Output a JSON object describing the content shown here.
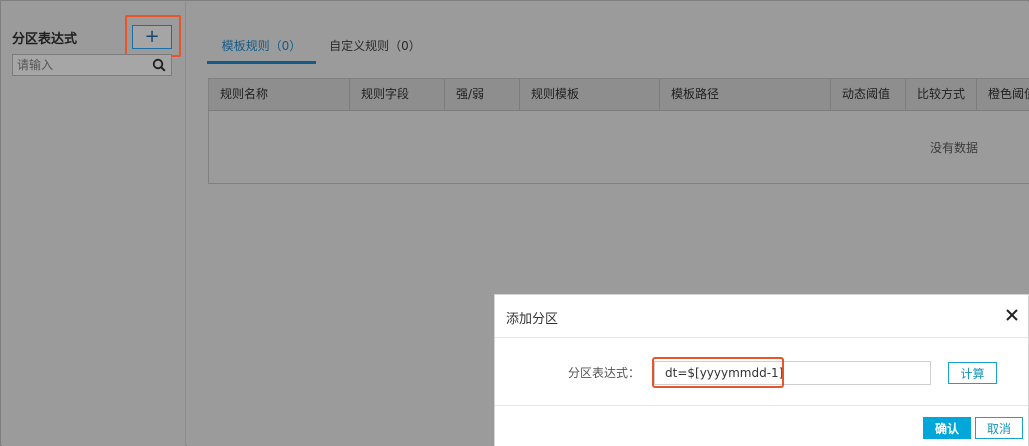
{
  "sidebar": {
    "title": "分区表达式",
    "add_label": "+",
    "search_placeholder": "请输入"
  },
  "tabs": [
    {
      "label": "模板规则（0）",
      "active": true
    },
    {
      "label": "自定义规则（0）",
      "active": false
    }
  ],
  "table": {
    "columns": [
      "规则名称",
      "规则字段",
      "强/弱",
      "规则模板",
      "模板路径",
      "动态阈值",
      "比较方式",
      "橙色阈值"
    ],
    "empty_text": "没有数据"
  },
  "dialog": {
    "title": "添加分区",
    "field_label": "分区表达式：",
    "expression_value": "dt=$[yyyymmdd-1]",
    "calc_label": "计算",
    "ok_label": "确认",
    "cancel_label": "取消"
  },
  "colors": {
    "accent": "#00a7d8",
    "highlight": "#e8552a",
    "overlay": "#9b9b9b"
  }
}
